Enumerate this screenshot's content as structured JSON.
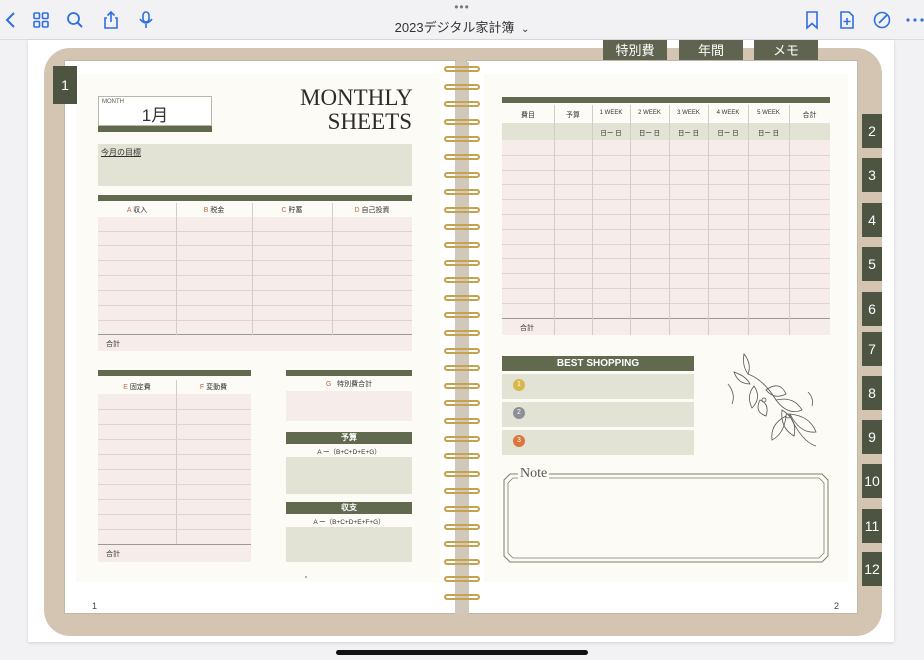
{
  "toolbar": {
    "title": "2023デジタル家計簿",
    "chevron": "⌄",
    "dots": "•••"
  },
  "top_tabs": [
    "特別費",
    "年間",
    "メモ"
  ],
  "side_tabs": [
    "2",
    "3",
    "4",
    "5",
    "6",
    "7",
    "8",
    "9",
    "10",
    "11",
    "12"
  ],
  "left_page": {
    "tab_number": "1",
    "month_small_label": "MONTH",
    "month_value": "1月",
    "title_line1": "MONTHLY",
    "title_line2": "SHEETS",
    "goal_label": "今月の目標",
    "income_headers": [
      {
        "letter": "A",
        "label": "収入"
      },
      {
        "letter": "B",
        "label": "税金"
      },
      {
        "letter": "C",
        "label": "貯蓄"
      },
      {
        "letter": "D",
        "label": "自己投資"
      }
    ],
    "total_label": "合計",
    "expense_headers": [
      {
        "letter": "E",
        "label": "固定費"
      },
      {
        "letter": "F",
        "label": "変動費"
      }
    ],
    "special_header": {
      "letter": "G",
      "label": "特別費合計"
    },
    "budget_label": "予算",
    "budget_formula": "A ー（B+C+D+E+G）",
    "balance_label": "収支",
    "balance_formula": "A ー（B+C+D+E+F+G）",
    "total_label2": "合計",
    "page_number": "1"
  },
  "right_page": {
    "headers": [
      "費目",
      "予算",
      "1 WEEK",
      "2 WEEK",
      "3 WEEK",
      "4 WEEK",
      "5 WEEK",
      "合計"
    ],
    "week_range": "日ー 日",
    "total_label": "合計",
    "best_shopping": "BEST SHOPPING",
    "medals": [
      "1",
      "2",
      "3"
    ],
    "note_label": "Note",
    "page_number": "2"
  },
  "colors": {
    "olive": "#616a4e",
    "sage": "#e2e3d5",
    "pink": "#f6ecea",
    "cover": "#d3c5b1",
    "ring": "#c5a24d",
    "ios_blue": "#2f6fe0"
  }
}
